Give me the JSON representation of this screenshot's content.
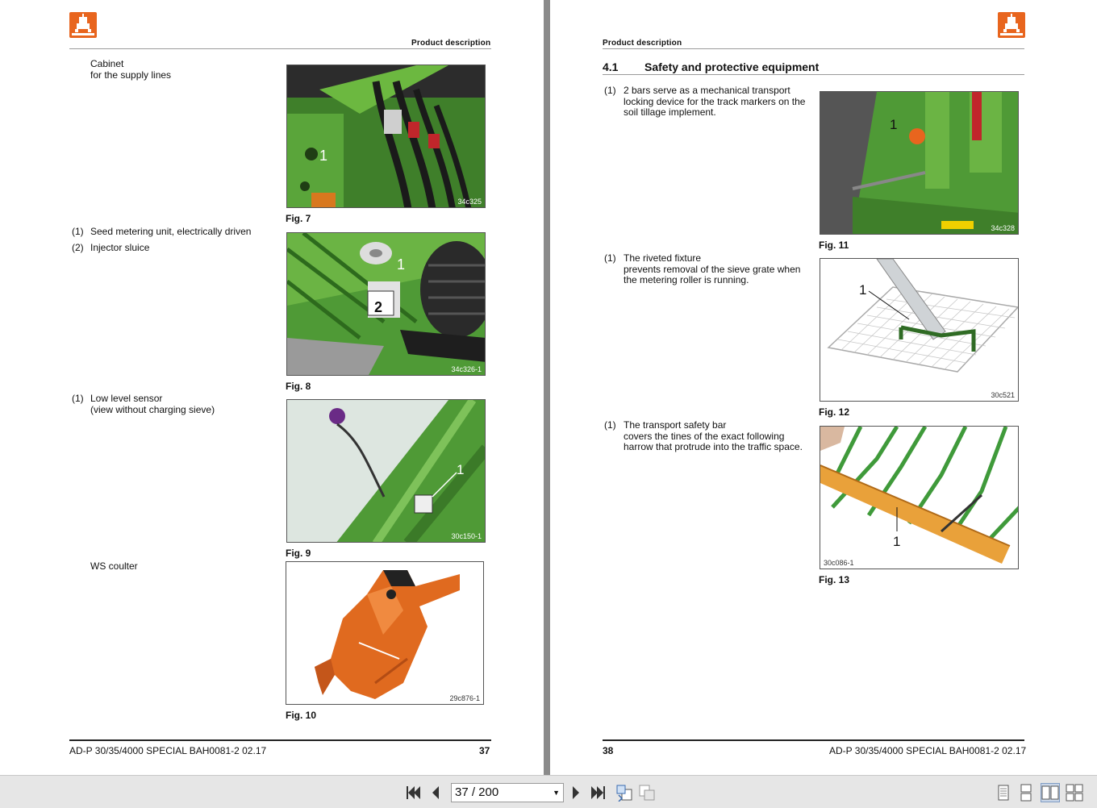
{
  "left_page": {
    "running_head": "Product description",
    "items": [
      {
        "num": "",
        "lines": [
          "Cabinet",
          "for the supply lines"
        ]
      },
      {
        "num": "(1)",
        "lines": [
          "Seed metering unit, electrically driven"
        ]
      },
      {
        "num": "(2)",
        "lines": [
          "Injector sluice"
        ]
      },
      {
        "num": "(1)",
        "lines": [
          "Low level sensor",
          "(view without charging sieve)"
        ]
      },
      {
        "num": "",
        "lines": [
          "WS coulter"
        ]
      }
    ],
    "figures": [
      {
        "caption": "Fig. 7",
        "code": "34c325",
        "callouts": [
          "1"
        ]
      },
      {
        "caption": "Fig. 8",
        "code": "34c326-1",
        "callouts": [
          "1",
          "2"
        ]
      },
      {
        "caption": "Fig. 9",
        "code": "30c150-1",
        "callouts": [
          "1"
        ]
      },
      {
        "caption": "Fig. 10",
        "code": "29c876-1",
        "callouts": []
      }
    ],
    "footer_title": "AD-P 30/35/4000 SPECIAL  BAH0081-2  02.17",
    "page_number": "37"
  },
  "right_page": {
    "running_head": "Product description",
    "section_number": "4.1",
    "section_title": "Safety and protective equipment",
    "items": [
      {
        "num": "(1)",
        "lines": [
          "2 bars serve as a mechanical transport",
          "locking device for the track markers on the",
          "soil tillage implement."
        ]
      },
      {
        "num": "(1)",
        "lines": [
          "The riveted fixture",
          "prevents removal of the sieve grate when",
          "the metering roller is running."
        ]
      },
      {
        "num": "(1)",
        "lines": [
          "The transport safety bar",
          "covers the tines of the exact following",
          "harrow that protrude into the traffic space."
        ]
      }
    ],
    "figures": [
      {
        "caption": "Fig. 11",
        "code": "34c328",
        "callouts": [
          "1"
        ]
      },
      {
        "caption": "Fig. 12",
        "code": "30c521",
        "callouts": [
          "1"
        ]
      },
      {
        "caption": "Fig. 13",
        "code": "30c086-1",
        "callouts": [
          "1"
        ]
      }
    ],
    "footer_title": "AD-P 30/35/4000 SPECIAL  BAH0081-2  02.17",
    "page_number": "38"
  },
  "toolbar": {
    "page_indicator": "37 / 200",
    "icons": [
      "first-page-icon",
      "prev-page-icon",
      "next-page-icon",
      "last-page-icon",
      "back-view-icon",
      "forward-view-icon",
      "single-page-icon",
      "continuous-icon",
      "two-page-icon",
      "two-page-continuous-icon"
    ]
  },
  "colors": {
    "brand_orange": "#e8651e",
    "machine_green": "#4f9a36",
    "viewer_bg": "#8a8a8a",
    "toolbar_bg": "#e6e6e6"
  }
}
